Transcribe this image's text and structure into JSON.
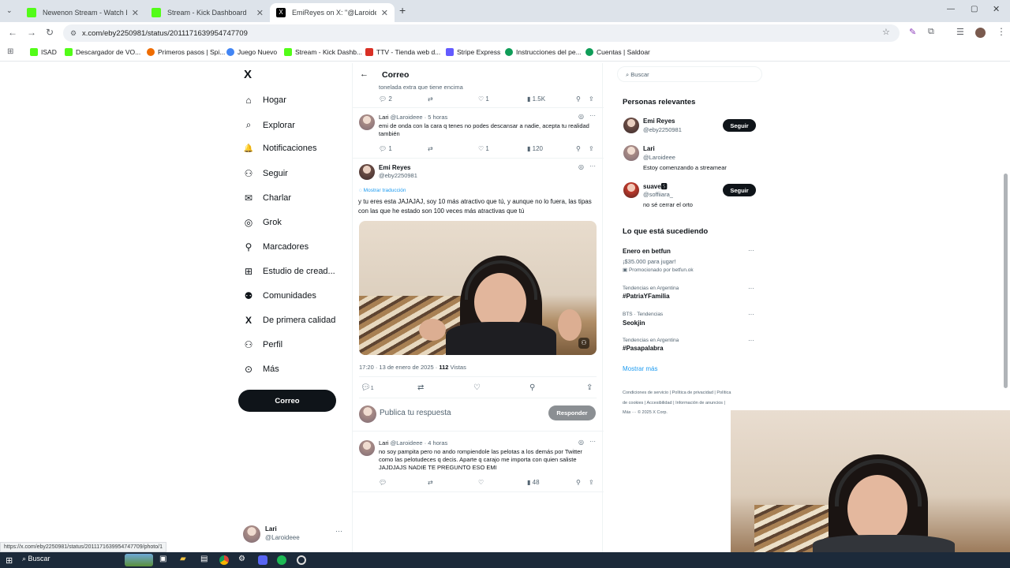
{
  "browser": {
    "tabs": [
      {
        "title": "Newenon Stream - Watch Live"
      },
      {
        "title": "Stream - Kick Dashboard"
      },
      {
        "title": "EmiReyes on X: \"@Laroideee G"
      }
    ],
    "new_tab": "+",
    "url": "x.com/eby2250981/status/2011171639954747709",
    "bookmarks": [
      "ISAD",
      "Descargador de VO...",
      "Primeros pasos | Spi...",
      "Juego Nuevo",
      "Stream - Kick Dashb...",
      "TTV - Tienda web d...",
      "Stripe Express",
      "Instrucciones del pe...",
      "Cuentas | Saldoar"
    ],
    "status_url": "https://x.com/eby2250981/status/2011171639954747709/photo/1"
  },
  "nav": {
    "logo": "X",
    "items": [
      {
        "label": "Hogar",
        "icon": "⌂"
      },
      {
        "label": "Explorar",
        "icon": "⌕"
      },
      {
        "label": "Notificaciones",
        "icon": "🔔"
      },
      {
        "label": "Seguir",
        "icon": "⚇"
      },
      {
        "label": "Charlar",
        "icon": "✉"
      },
      {
        "label": "Grok",
        "icon": "◎"
      },
      {
        "label": "Marcadores",
        "icon": "⚲"
      },
      {
        "label": "Estudio de cread...",
        "icon": "⊞"
      },
      {
        "label": "Comunidades",
        "icon": "⚉"
      },
      {
        "label": "De primera calidad",
        "icon": "X"
      },
      {
        "label": "Perfil",
        "icon": "⚇"
      },
      {
        "label": "Más",
        "icon": "⊙"
      }
    ],
    "post_button": "Correo",
    "account": {
      "name": "Lari",
      "handle": "@Laroideee",
      "more": "···"
    }
  },
  "header": {
    "back": "←",
    "title": "Correo"
  },
  "partial_tweet": {
    "text": "tonelada extra que tiene encima",
    "replies": "2",
    "likes": "1",
    "views": "1.5K"
  },
  "reply1": {
    "name": "Lari",
    "handle": "@Laroideee",
    "time": "· 5 horas",
    "text": "emi de onda con la cara q tenes no podes descansar a nadie, acepta tu realidad también",
    "replies": "1",
    "likes": "1",
    "views": "120"
  },
  "main_tweet": {
    "name": "Emi Reyes",
    "handle": "@eby2250981",
    "translate": "Mostrar traducción",
    "text": "y tu eres esta JAJAJAJ, soy 10 más atractivo que tú, y aunque no lo fuera, las tipas con las que he estado son 100 veces más atractivas que tú",
    "date": "17:20 · 13 de enero de 2025 ·",
    "views_count": "112",
    "views_label": "Vistas",
    "replies": "1"
  },
  "reply_box": {
    "placeholder": "Publica tu respuesta",
    "button": "Responder"
  },
  "reply2": {
    "name": "Lari",
    "handle": "@Laroideee",
    "time": "· 4 horas",
    "text": "no soy pampita pero no ando rompiendole las pelotas a los demás por Twitter como las pelotudeces q decis. Aparte q carajo me importa con quien saliste JAJDJAJS NADIE TE PREGUNTO ESO EMI",
    "views": "48"
  },
  "search": {
    "placeholder": "Buscar"
  },
  "relevant": {
    "title": "Personas relevantes",
    "people": [
      {
        "name": "Emi Reyes",
        "handle": "@eby2250981",
        "bio": "",
        "button": "Seguir"
      },
      {
        "name": "Lari",
        "handle": "@Laroideee",
        "bio": "Estoy comenzando a streamear",
        "button": ""
      },
      {
        "name": "suave🆂",
        "handle": "@soffiiara_",
        "bio": "no sé cerrar el orto",
        "button": "Seguir"
      }
    ]
  },
  "trends": {
    "title": "Lo que está sucediendo",
    "items": [
      {
        "context": "",
        "name": "Enero en betfun",
        "sub": "¡$35.000 para jugar!",
        "promo": "Promocionado por betfun.ok"
      },
      {
        "context": "Tendencias en Argentina",
        "name": "#PatriaYFamilia",
        "sub": "",
        "promo": ""
      },
      {
        "context": "BTS · Tendencias",
        "name": "Seokjin",
        "sub": "",
        "promo": ""
      },
      {
        "context": "Tendencias en Argentina",
        "name": "#Pasapalabra",
        "sub": "",
        "promo": ""
      }
    ],
    "more": "Mostrar más"
  },
  "footer": {
    "links": [
      "Condiciones de servicio",
      "Política de privacidad",
      "Política de cookies",
      "Accesibilidad",
      "Información de anuncios",
      "Más ···",
      "© 2025 X Corp."
    ]
  },
  "taskbar": {
    "search": "Buscar"
  }
}
